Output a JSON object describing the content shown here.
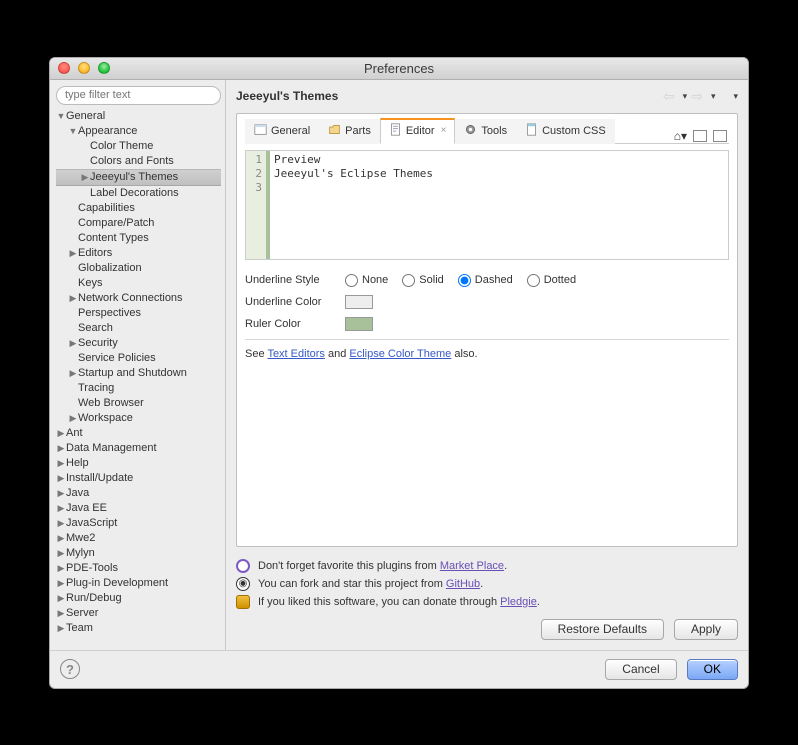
{
  "window": {
    "title": "Preferences"
  },
  "filter": {
    "placeholder": "type filter text"
  },
  "tree": [
    {
      "label": "General",
      "level": 0,
      "arrow": "▼"
    },
    {
      "label": "Appearance",
      "level": 1,
      "arrow": "▼"
    },
    {
      "label": "Color Theme",
      "level": 2,
      "arrow": ""
    },
    {
      "label": "Colors and Fonts",
      "level": 2,
      "arrow": ""
    },
    {
      "label": "Jeeeyul's Themes",
      "level": 2,
      "arrow": "▶",
      "selected": true
    },
    {
      "label": "Label Decorations",
      "level": 2,
      "arrow": ""
    },
    {
      "label": "Capabilities",
      "level": 1,
      "arrow": ""
    },
    {
      "label": "Compare/Patch",
      "level": 1,
      "arrow": ""
    },
    {
      "label": "Content Types",
      "level": 1,
      "arrow": ""
    },
    {
      "label": "Editors",
      "level": 1,
      "arrow": "▶"
    },
    {
      "label": "Globalization",
      "level": 1,
      "arrow": ""
    },
    {
      "label": "Keys",
      "level": 1,
      "arrow": ""
    },
    {
      "label": "Network Connections",
      "level": 1,
      "arrow": "▶"
    },
    {
      "label": "Perspectives",
      "level": 1,
      "arrow": ""
    },
    {
      "label": "Search",
      "level": 1,
      "arrow": ""
    },
    {
      "label": "Security",
      "level": 1,
      "arrow": "▶"
    },
    {
      "label": "Service Policies",
      "level": 1,
      "arrow": ""
    },
    {
      "label": "Startup and Shutdown",
      "level": 1,
      "arrow": "▶"
    },
    {
      "label": "Tracing",
      "level": 1,
      "arrow": ""
    },
    {
      "label": "Web Browser",
      "level": 1,
      "arrow": ""
    },
    {
      "label": "Workspace",
      "level": 1,
      "arrow": "▶"
    },
    {
      "label": "Ant",
      "level": 0,
      "arrow": "▶"
    },
    {
      "label": "Data Management",
      "level": 0,
      "arrow": "▶"
    },
    {
      "label": "Help",
      "level": 0,
      "arrow": "▶"
    },
    {
      "label": "Install/Update",
      "level": 0,
      "arrow": "▶"
    },
    {
      "label": "Java",
      "level": 0,
      "arrow": "▶"
    },
    {
      "label": "Java EE",
      "level": 0,
      "arrow": "▶"
    },
    {
      "label": "JavaScript",
      "level": 0,
      "arrow": "▶"
    },
    {
      "label": "Mwe2",
      "level": 0,
      "arrow": "▶"
    },
    {
      "label": "Mylyn",
      "level": 0,
      "arrow": "▶"
    },
    {
      "label": "PDE-Tools",
      "level": 0,
      "arrow": "▶"
    },
    {
      "label": "Plug-in Development",
      "level": 0,
      "arrow": "▶"
    },
    {
      "label": "Run/Debug",
      "level": 0,
      "arrow": "▶"
    },
    {
      "label": "Server",
      "level": 0,
      "arrow": "▶"
    },
    {
      "label": "Team",
      "level": 0,
      "arrow": "▶"
    }
  ],
  "page": {
    "title": "Jeeeyul's Themes"
  },
  "tabs": {
    "items": [
      {
        "label": "General"
      },
      {
        "label": "Parts"
      },
      {
        "label": "Editor"
      },
      {
        "label": "Tools"
      },
      {
        "label": "Custom CSS"
      }
    ],
    "activeIndex": 2
  },
  "editorPreview": {
    "lines": [
      "Preview",
      "Jeeeyul's Eclipse Themes",
      ""
    ]
  },
  "form": {
    "underlineStyle": {
      "label": "Underline Style",
      "options": [
        "None",
        "Solid",
        "Dashed",
        "Dotted"
      ],
      "selected": "Dashed"
    },
    "underlineColor": {
      "label": "Underline Color",
      "value": "#eeeeee"
    },
    "rulerColor": {
      "label": "Ruler Color",
      "value": "#a9c19a"
    },
    "seePrefix": "See ",
    "seeLink1": "Text Editors",
    "seeMid": " and ",
    "seeLink2": "Eclipse Color Theme",
    "seeSuffix": " also."
  },
  "info": {
    "row1a": "Don't forget favorite this plugins from ",
    "row1link": "Market Place",
    "row1b": ".",
    "row2a": "You can fork and star this project from ",
    "row2link": "GitHub",
    "row2b": ".",
    "row3a": "If you liked this software, you can donate through ",
    "row3link": "Pledgie",
    "row3b": "."
  },
  "buttons": {
    "restore": "Restore Defaults",
    "apply": "Apply",
    "cancel": "Cancel",
    "ok": "OK"
  }
}
